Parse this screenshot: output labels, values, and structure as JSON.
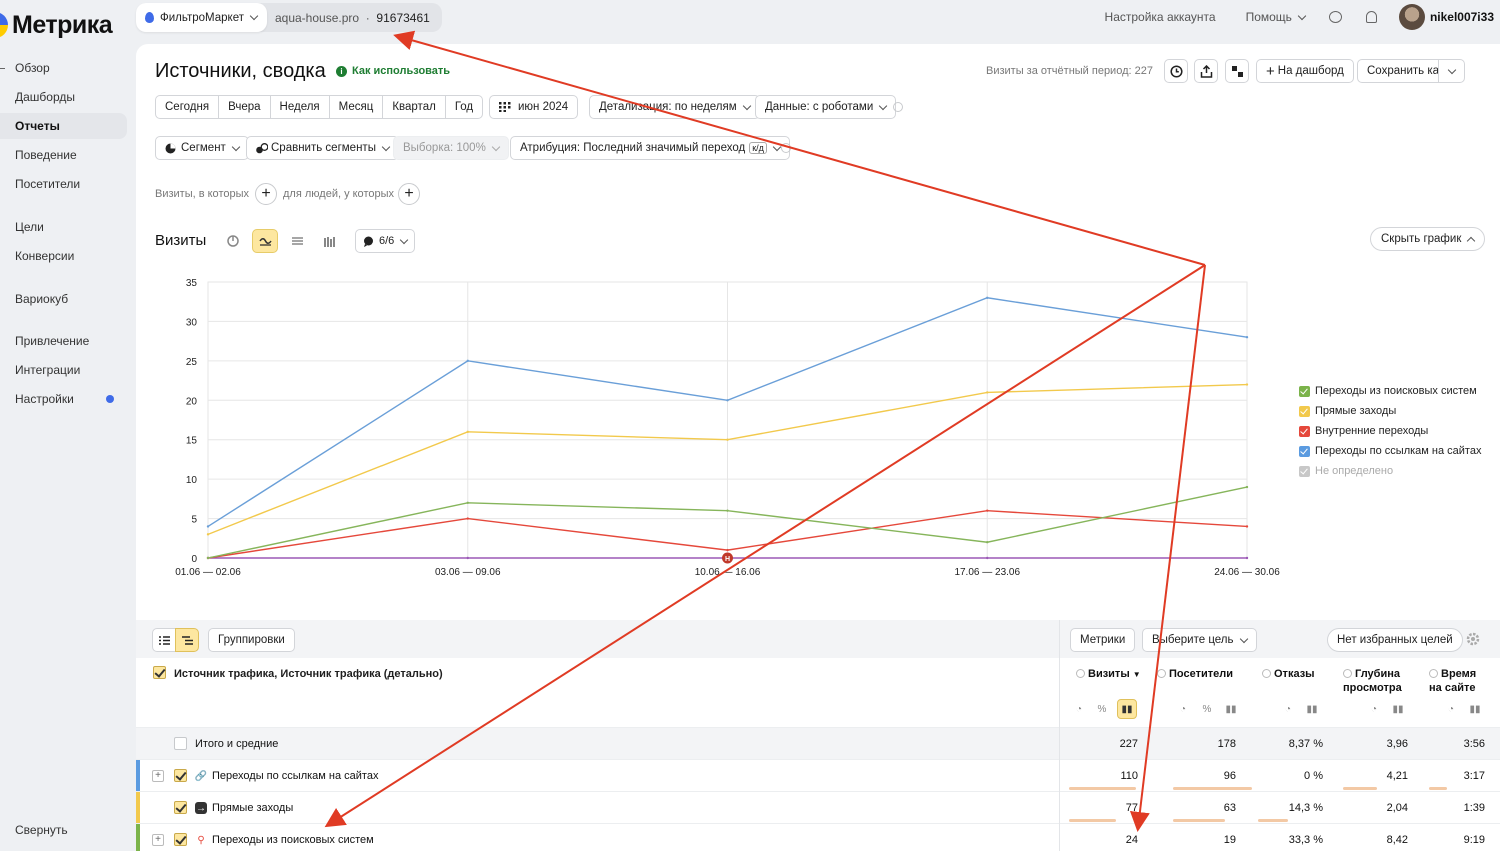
{
  "app": {
    "logo_text": "Метрика"
  },
  "sidebar": {
    "items": [
      {
        "label": "Обзор"
      },
      {
        "label": "Дашборды"
      },
      {
        "label": "Отчеты"
      },
      {
        "label": "Поведение"
      },
      {
        "label": "Посетители"
      },
      {
        "label": "Цели"
      },
      {
        "label": "Конверсии"
      },
      {
        "label": "Вариокуб"
      },
      {
        "label": "Привлечение"
      },
      {
        "label": "Интеграции"
      },
      {
        "label": "Настройки"
      }
    ],
    "collapse_label": "Свернуть"
  },
  "topbar": {
    "counter_name": "ФильтроМаркет",
    "site": "aqua-house.pro",
    "counter_id": "91673461",
    "account_settings": "Настройка аккаунта",
    "help": "Помощь",
    "username": "nikel007i33"
  },
  "header": {
    "title": "Источники, сводка",
    "howto": "Как использовать",
    "visits_period": "Визиты за отчётный период: 227",
    "to_dashboard": "На дашборд",
    "save_as": "Сохранить как"
  },
  "filters": {
    "periods": [
      "Сегодня",
      "Вчера",
      "Неделя",
      "Месяц",
      "Квартал",
      "Год"
    ],
    "date": "июн 2024",
    "detail": "Детализация: по неделям",
    "data": "Данные: с роботами",
    "segment": "Сегмент",
    "compare": "Сравнить сегменты",
    "sample": "Выборка: 100%",
    "attribution": "Атрибуция: Последний значимый переход",
    "attribution_badge": "к/д",
    "visits_where": "Визиты, в которых",
    "people_where": "для людей, у которых"
  },
  "chart": {
    "title": "Визиты",
    "notes": "6/6",
    "hide": "Скрыть график",
    "legend": [
      {
        "label": "Переходы из поисковых систем",
        "color": "#7bb34a",
        "enabled": true
      },
      {
        "label": "Прямые заходы",
        "color": "#f2c94c",
        "enabled": true
      },
      {
        "label": "Внутренние переходы",
        "color": "#e5483b",
        "enabled": true
      },
      {
        "label": "Переходы по ссылкам на сайтах",
        "color": "#5b9be0",
        "enabled": true
      },
      {
        "label": "Не определено",
        "color": "#c8c8c8",
        "enabled": false
      }
    ]
  },
  "chart_data": {
    "type": "line",
    "categories": [
      "01.06 — 02.06",
      "03.06 — 09.06",
      "10.06 — 16.06",
      "17.06 — 23.06",
      "24.06 — 30.06"
    ],
    "ylim": [
      0,
      35
    ],
    "yticks": [
      0,
      5,
      10,
      15,
      20,
      25,
      30,
      35
    ],
    "series": [
      {
        "name": "Переходы по ссылкам на сайтах",
        "color": "#6a9fd8",
        "values": [
          4,
          25,
          20,
          33,
          28
        ]
      },
      {
        "name": "Прямые заходы",
        "color": "#f2c94c",
        "values": [
          3,
          16,
          15,
          21,
          22
        ]
      },
      {
        "name": "Переходы из поисковых систем",
        "color": "#86b55b",
        "values": [
          0,
          7,
          6,
          2,
          9
        ]
      },
      {
        "name": "Внутренние переходы",
        "color": "#e5483b",
        "values": [
          0,
          5,
          1,
          6,
          4
        ]
      },
      {
        "name": "Не определено",
        "color": "#9b59b6",
        "values": [
          0,
          0,
          0,
          0,
          0
        ]
      }
    ],
    "marker_label": "H"
  },
  "table": {
    "groupings": "Группировки",
    "metrics": "Метрики",
    "choose_goal": "Выберите цель",
    "no_goals": "Нет избранных целей",
    "dimension_header": "Источник трафика, Источник трафика (детально)",
    "columns": [
      "Визиты",
      "Посетители",
      "Отказы",
      "Глубина просмотра",
      "Время на сайте"
    ],
    "total": {
      "label": "Итого и средние",
      "values": [
        "227",
        "178",
        "8,37 %",
        "3,96",
        "3:56"
      ]
    },
    "rows": [
      {
        "label": "Переходы по ссылкам на сайтах",
        "color": "#5b9be0",
        "values": [
          "110",
          "96",
          "0 %",
          "4,21",
          "3:17"
        ]
      },
      {
        "label": "Прямые заходы",
        "color": "#f2c94c",
        "values": [
          "77",
          "63",
          "14,3 %",
          "2,04",
          "1:39"
        ]
      },
      {
        "label": "Переходы из поисковых систем",
        "color": "#7bb34a",
        "values": [
          "24",
          "19",
          "33,3 %",
          "8,42",
          "9:19"
        ]
      }
    ]
  }
}
